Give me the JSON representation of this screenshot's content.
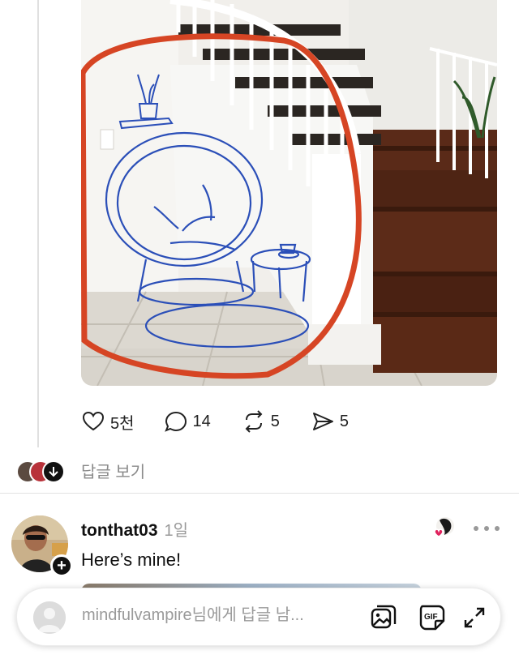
{
  "post": {
    "image_desc_icon": "photo-icon",
    "actions": [
      {
        "name": "like",
        "icon": "heart-icon",
        "count": "5천"
      },
      {
        "name": "comment",
        "icon": "comment-icon",
        "count": "14"
      },
      {
        "name": "repost",
        "icon": "repost-icon",
        "count": "5"
      },
      {
        "name": "share",
        "icon": "send-icon",
        "count": "5"
      }
    ]
  },
  "replies": {
    "view_label": "답글 보기"
  },
  "reply": {
    "username": "tonthat03",
    "time": "1일",
    "text": "Here’s mine!",
    "follow_icon": "plus-icon",
    "more_icon": "more-icon"
  },
  "composer": {
    "placeholder": "mindfulvampire님에게 답글 남...",
    "buttons": [
      "gallery-icon",
      "gif-icon",
      "expand-icon"
    ]
  },
  "colors": {
    "text": "#111111",
    "muted": "#8a8a8a",
    "accent_like": "#e0245e",
    "sketch_blue": "#2b4fb8",
    "sketch_red": "#d64524"
  }
}
